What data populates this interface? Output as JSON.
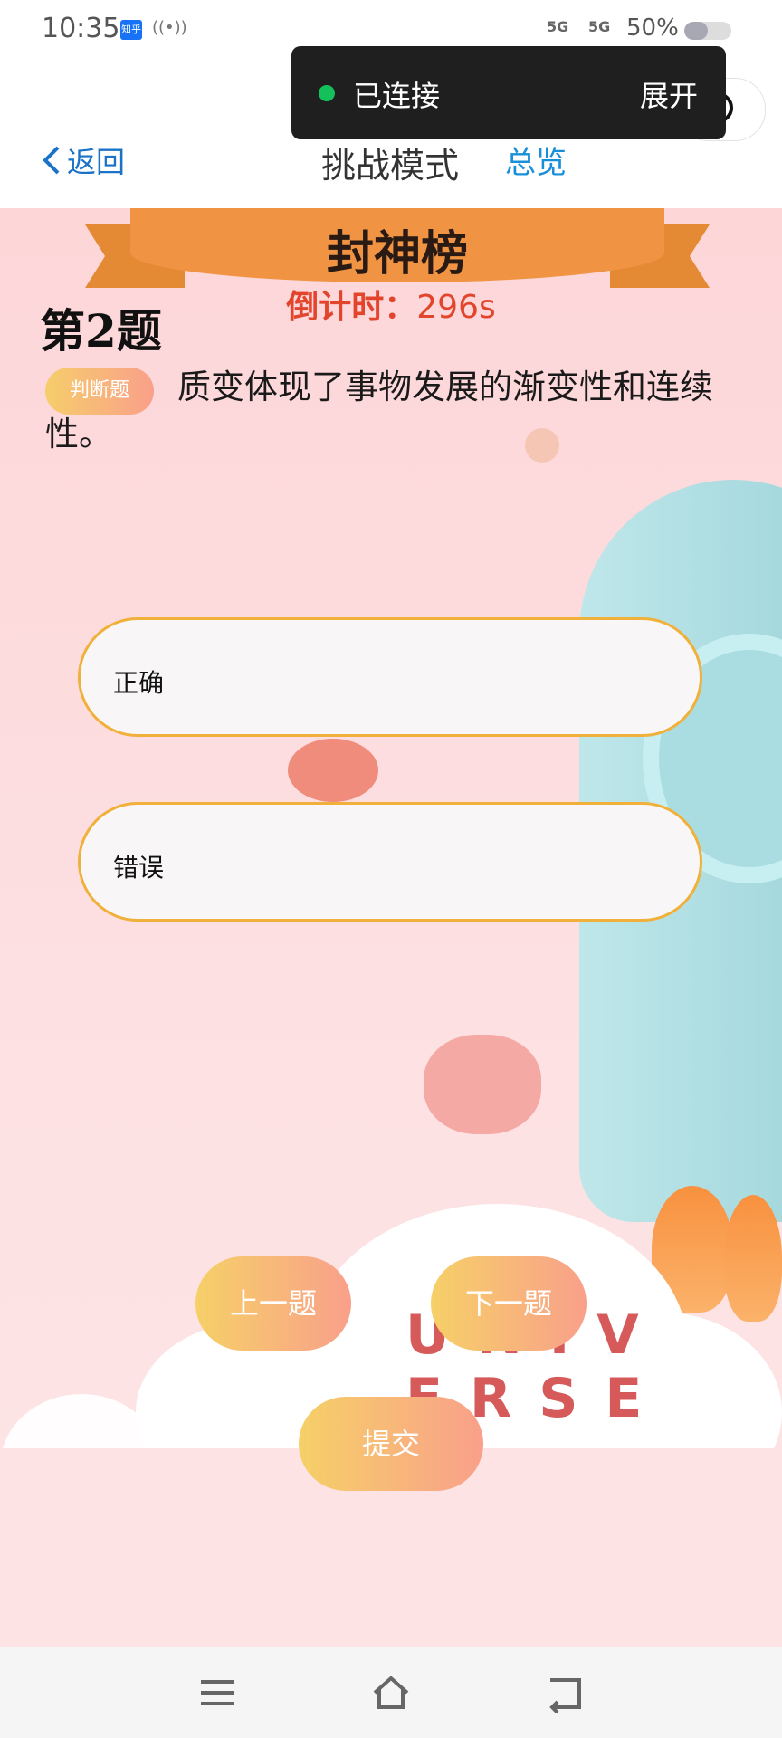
{
  "status_bar": {
    "time": "10:35",
    "app_badge": "知乎",
    "hotspot": "((•))",
    "signal_1": "5G",
    "signal_2": "5G",
    "battery_text": "50%",
    "battery_level": 0.5
  },
  "toast": {
    "status": "已连接",
    "expand_label": "展开",
    "dot_color": "#13c05a"
  },
  "nav": {
    "back_label": "返回",
    "title": "挑战模式",
    "overview_label": "总览",
    "accent_color": "#1a8fd9"
  },
  "banner": {
    "title": "封神榜"
  },
  "countdown": {
    "label": "倒计时：",
    "value": "296s"
  },
  "question": {
    "number_label": "第2题",
    "type_badge": "判断题",
    "text": "质变体现了事物发展的渐变性和连续性。"
  },
  "options": [
    {
      "label": "正确"
    },
    {
      "label": "错误"
    }
  ],
  "buttons": {
    "prev": "上一题",
    "next": "下一题",
    "submit": "提交"
  },
  "background_text": {
    "line1": "UNIV",
    "line2": "ERSE"
  },
  "system_nav": {
    "menu_icon": "menu-icon",
    "home_icon": "home-icon",
    "back_icon": "back-icon"
  }
}
